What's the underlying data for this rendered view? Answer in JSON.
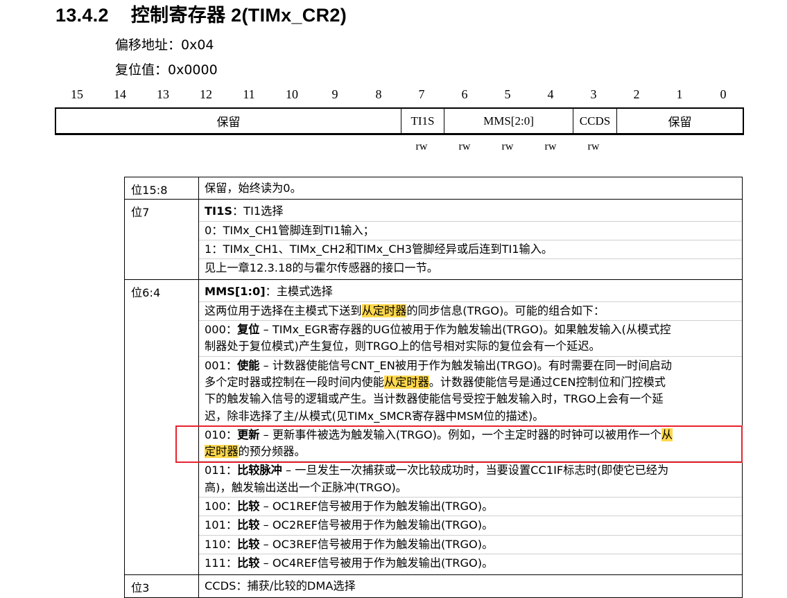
{
  "section": {
    "number": "13.4.2",
    "title": "控制寄存器 2(TIMx_CR2)"
  },
  "offset": "偏移地址：0x04",
  "reset": "复位值：0x0000",
  "bit_numbers": [
    "15",
    "14",
    "13",
    "12",
    "11",
    "10",
    "9",
    "8",
    "7",
    "6",
    "5",
    "4",
    "3",
    "2",
    "1",
    "0"
  ],
  "fields": [
    {
      "label": "保留",
      "bits": 8
    },
    {
      "label": "TI1S",
      "bits": 1
    },
    {
      "label": "MMS[2:0]",
      "bits": 3
    },
    {
      "label": "CCDS",
      "bits": 1
    },
    {
      "label": "保留",
      "bits": 3
    }
  ],
  "access": [
    "rw",
    "rw",
    "rw",
    "rw",
    "rw"
  ],
  "rows": [
    {
      "bits": "位15:8",
      "lines": [
        "保留，始终读为0。"
      ]
    },
    {
      "bits": "位7",
      "l1_bold": "TI1S",
      "l1_rest": "：TI1选择",
      "l2": "0：TIMx_CH1管脚连到TI1输入；",
      "l3": "1：TIMx_CH1、TIMx_CH2和TIMx_CH3管脚经异或后连到TI1输入。",
      "l4": "见上一章12.3.18的与霍尔传感器的接口一节。"
    },
    {
      "bits": "位6:4",
      "title_bold": "MMS[1:0]",
      "title_rest": "：主模式选择",
      "intro_a": "这两位用于选择在主模式下送到",
      "intro_hl": "从定时器",
      "intro_b": "的同步信息(TRGO)。可能的组合如下：",
      "m000_code": "000：",
      "m000_bold": "复位",
      "m000_a": " – TIMx_EGR寄存器的UG位被用于作为触发输出(TRGO)。如果触发输入(从模式控",
      "m000_b": "制器处于复位模式)产生复位，则TRGO上的信号相对实际的复位会有一个延迟。",
      "m001_code": "001：",
      "m001_bold": "使能",
      "m001_a": " – 计数器使能信号CNT_EN被用于作为触发输出(TRGO)。有时需要在同一时间启动",
      "m001_b1": "多个定时器或控制在一段时间内使能",
      "m001_hl": "从定时器",
      "m001_b2": "。计数器使能信号是通过CEN控制位和门控模式",
      "m001_c": "下的触发输入信号的逻辑或产生。当计数器使能信号受控于触发输入时，TRGO上会有一个延",
      "m001_d": "迟，除非选择了主/从模式(见TIMx_SMCR寄存器中MSM位的描述)。",
      "m010_code": "010：",
      "m010_bold": "更新",
      "m010_a1": " – 更新事件被选为触发输入(TRGO)。例如，一个主定时器的时钟可以被用作一个",
      "m010_hl1": "从",
      "m010_hl2": "定时器",
      "m010_b": "的预分频器。",
      "m011_code": "011：",
      "m011_bold": "比较脉冲",
      "m011_a": " – 一旦发生一次捕获或一次比较成功时，当要设置CC1IF标志时(即使它已经为",
      "m011_b": "高)，触发输出送出一个正脉冲(TRGO)。",
      "m100_code": "100：",
      "m100_bold": "比较",
      "m100_a": " – OC1REF信号被用于作为触发输出(TRGO)。",
      "m101_code": "101：",
      "m101_bold": "比较",
      "m101_a": " – OC2REF信号被用于作为触发输出(TRGO)。",
      "m110_code": "110：",
      "m110_bold": "比较",
      "m110_a": " – OC3REF信号被用于作为触发输出(TRGO)。",
      "m111_code": "111：",
      "m111_bold": "比较",
      "m111_a": " – OC4REF信号被用于作为触发输出(TRGO)。"
    },
    {
      "bits": "位3",
      "partial": "CCDS：捕获/比较的DMA选择"
    }
  ],
  "colors": {
    "highlight": "#ffd84d",
    "redbox": "#e8222e"
  }
}
